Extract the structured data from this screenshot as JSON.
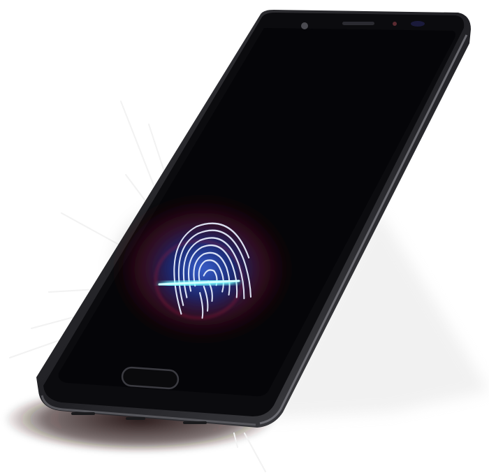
{
  "image": {
    "subject": "phone-fingerprint-render",
    "icons": [
      "fingerprint-icon",
      "home-button-icon",
      "front-camera-icon",
      "earpiece-icon",
      "sensor-icon"
    ],
    "colors": {
      "background": "#ffffff",
      "body": "#2a2a2c",
      "bezel": "#111114",
      "screen": "#050508",
      "glow_blue": "#3a6bff",
      "glow_red": "#b0203a",
      "scan_line": "#38f0f0",
      "rays": "#f5f5f5"
    }
  }
}
